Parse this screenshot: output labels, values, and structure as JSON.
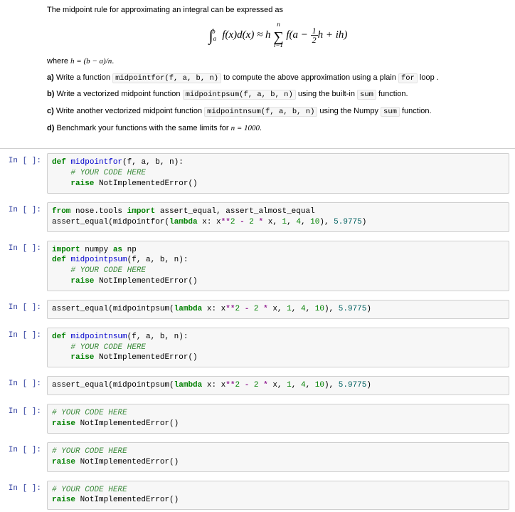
{
  "intro": {
    "p1": "The midpoint rule for approximating an integral can be expressed as",
    "p2_prefix": "where ",
    "p2_math": "h = (b − a)/n",
    "p2_suffix": ".",
    "a_bold": "a)",
    "a_text1": " Write a function ",
    "a_code1": "midpointfor(f, a, b, n)",
    "a_text2": " to compute the above approximation using a plain ",
    "a_code2": "for",
    "a_text3": " loop ",
    "a_text4": ".",
    "b_bold": "b)",
    "b_text1": " Write a vectorized midpoint function ",
    "b_code1": "midpointpsum(f, a, b, n)",
    "b_text2": " using the built-in ",
    "b_code2": "sum",
    "b_text3": " function.",
    "c_bold": "c)",
    "c_text1": " Write another vectorized midpoint function ",
    "c_code1": "midpointnsum(f, a, b, n)",
    "c_text2": " using the Numpy ",
    "c_code2": "sum",
    "c_text3": " function.",
    "d_bold": "d)",
    "d_text1": " Benchmark your functions with the same limits for ",
    "d_math": "n = 1000",
    "d_text2": "."
  },
  "math": {
    "int_a": "a",
    "int_b": "b",
    "integrand": "f(x)d(x) ≈ h",
    "sum_top": "n",
    "sum_bot": "i=1",
    "after_sum": " f(a − ",
    "frac_num": "1",
    "frac_den": "2",
    "after_frac": "h + ih)"
  },
  "prompt": "In [ ]:",
  "cells": [
    {
      "html": "<span class=\"tok-kw\">def</span> <span class=\"tok-fn\">midpointfor</span>(f, a, b, n):\n    <span class=\"tok-cm\"># YOUR CODE HERE</span>\n    <span class=\"tok-kw\">raise</span> NotImplementedError()"
    },
    {
      "html": "<span class=\"tok-kw\">from</span> nose.tools <span class=\"tok-kw\">import</span> assert_equal, assert_almost_equal\nassert_equal(midpointfor(<span class=\"tok-kw\">lambda</span> x: x<span class=\"tok-op\">**</span><span class=\"tok-num\">2</span> <span class=\"tok-op\">-</span> <span class=\"tok-num\">2</span> <span class=\"tok-op\">*</span> x, <span class=\"tok-num\">1</span>, <span class=\"tok-num\">4</span>, <span class=\"tok-num\">10</span>), <span class=\"tok-flt\">5.9775</span>)"
    },
    {
      "html": "<span class=\"tok-kw\">import</span> numpy <span class=\"tok-kw\">as</span> np\n<span class=\"tok-kw\">def</span> <span class=\"tok-fn\">midpointpsum</span>(f, a, b, n):\n    <span class=\"tok-cm\"># YOUR CODE HERE</span>\n    <span class=\"tok-kw\">raise</span> NotImplementedError()"
    },
    {
      "html": "assert_equal(midpointpsum(<span class=\"tok-kw\">lambda</span> x: x<span class=\"tok-op\">**</span><span class=\"tok-num\">2</span> <span class=\"tok-op\">-</span> <span class=\"tok-num\">2</span> <span class=\"tok-op\">*</span> x, <span class=\"tok-num\">1</span>, <span class=\"tok-num\">4</span>, <span class=\"tok-num\">10</span>), <span class=\"tok-flt\">5.9775</span>)"
    },
    {
      "html": "<span class=\"tok-kw\">def</span> <span class=\"tok-fn\">midpointnsum</span>(f, a, b, n):\n    <span class=\"tok-cm\"># YOUR CODE HERE</span>\n    <span class=\"tok-kw\">raise</span> NotImplementedError()"
    },
    {
      "html": "assert_equal(midpointpsum(<span class=\"tok-kw\">lambda</span> x: x<span class=\"tok-op\">**</span><span class=\"tok-num\">2</span> <span class=\"tok-op\">-</span> <span class=\"tok-num\">2</span> <span class=\"tok-op\">*</span> x, <span class=\"tok-num\">1</span>, <span class=\"tok-num\">4</span>, <span class=\"tok-num\">10</span>), <span class=\"tok-flt\">5.9775</span>)"
    },
    {
      "html": "<span class=\"tok-cm\"># YOUR CODE HERE</span>\n<span class=\"tok-kw\">raise</span> NotImplementedError()"
    },
    {
      "html": "<span class=\"tok-cm\"># YOUR CODE HERE</span>\n<span class=\"tok-kw\">raise</span> NotImplementedError()"
    },
    {
      "html": "<span class=\"tok-cm\"># YOUR CODE HERE</span>\n<span class=\"tok-kw\">raise</span> NotImplementedError()"
    }
  ]
}
